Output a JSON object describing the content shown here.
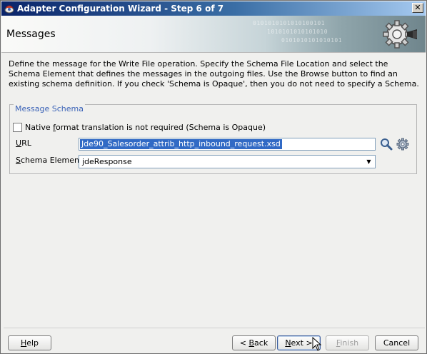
{
  "window": {
    "title": "Adapter Configuration Wizard - Step 6 of 7",
    "close_glyph": "✕"
  },
  "header": {
    "title": "Messages",
    "binary_lines": [
      "0101010101010100101",
      "1010101010101010",
      "0101010101010101"
    ]
  },
  "instructions": "Define the message for the Write File operation.  Specify the Schema File Location and select the Schema Element that defines the messages in the outgoing files. Use the Browse button to find an existing schema definition. If you check 'Schema is Opaque', then you do not need to specify a Schema.",
  "schema": {
    "legend": "Message Schema",
    "checkbox_label_pre": "Native ",
    "checkbox_label_mnemonic": "f",
    "checkbox_label_post": "ormat translation is not required (Schema is Opaque)",
    "checkbox_checked": false,
    "url_label_mnemonic": "U",
    "url_label_rest": "RL",
    "url_value": "Jde90_Salesorder_attrib_http_inbound_request.xsd",
    "schema_element_label_mnemonic": "S",
    "schema_element_label_rest": "chema Element",
    "schema_element_value": "jdeResponse"
  },
  "buttons": {
    "help_mnemonic": "H",
    "help_rest": "elp",
    "back_pre": "< ",
    "back_mnemonic": "B",
    "back_rest": "ack",
    "next_mnemonic": "N",
    "next_rest": "ext >",
    "finish_mnemonic": "F",
    "finish_rest": "inish",
    "cancel": "Cancel"
  },
  "icons": {
    "title": "adapter-cup-icon",
    "header": "gear-plug-icon",
    "search": "magnifier-icon",
    "settings": "gear-icon"
  },
  "colors": {
    "title_bar_start": "#0a246a",
    "legend_text": "#3a62b7",
    "selection": "#316ac5"
  }
}
